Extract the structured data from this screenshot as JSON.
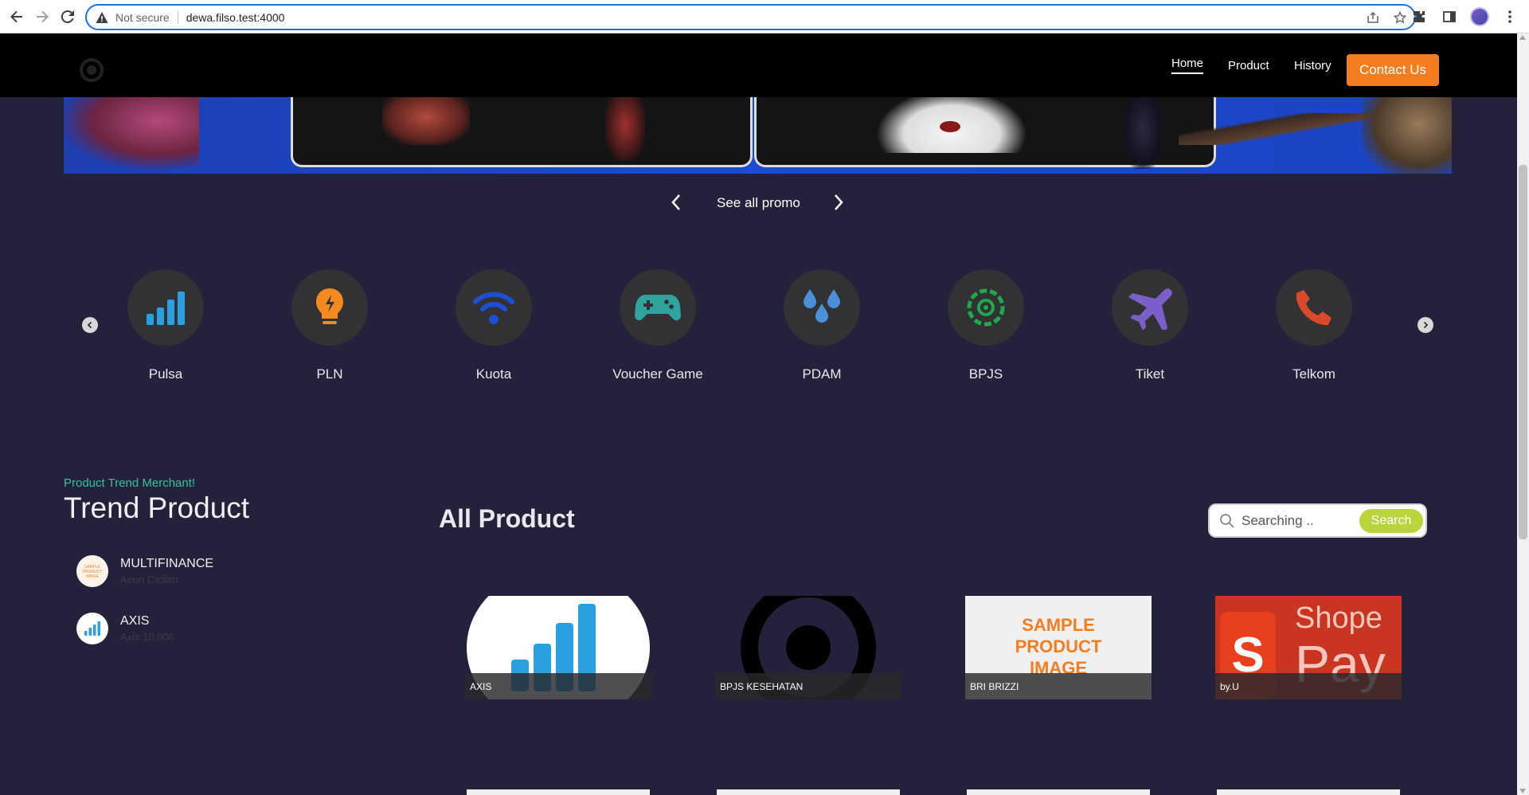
{
  "browser": {
    "security_label": "Not secure",
    "url": "dewa.filso.test:4000"
  },
  "site_nav": {
    "items": [
      {
        "label": "Home",
        "active": true
      },
      {
        "label": "Product",
        "active": false
      },
      {
        "label": "History",
        "active": false
      }
    ],
    "contact_label": "Contact Us",
    "accent": "#f47d1f"
  },
  "promo": {
    "label": "See all promo"
  },
  "categories": [
    {
      "label": "Pulsa",
      "icon": "signal-bars-icon",
      "color": "#2aa0e0"
    },
    {
      "label": "PLN",
      "icon": "lightbulb-icon",
      "color": "#f48a1d"
    },
    {
      "label": "Kuota",
      "icon": "wifi-icon",
      "color": "#1d4fd1"
    },
    {
      "label": "Voucher Game",
      "icon": "gamepad-icon",
      "color": "#2fa39d"
    },
    {
      "label": "PDAM",
      "icon": "water-drops-icon",
      "color": "#4a90d8"
    },
    {
      "label": "BPJS",
      "icon": "bpjs-logo-icon",
      "color": "#1fa94e"
    },
    {
      "label": "Tiket",
      "icon": "airplane-icon",
      "color": "#7b5fc9"
    },
    {
      "label": "Telkom",
      "icon": "phone-icon",
      "color": "#d84a2a"
    }
  ],
  "trend": {
    "subtitle": "Product Trend Merchant!",
    "title": "Trend Product",
    "items": [
      {
        "name": "MULTIFINANCE",
        "desc": "Aeon Cicilan",
        "thumb": "sample-product-image-icon"
      },
      {
        "name": "AXIS",
        "desc": "Axis 10.000",
        "thumb": "signal-bars-icon"
      }
    ]
  },
  "all_product": {
    "title": "All Product",
    "search_placeholder": "Searching ..",
    "search_label": "Search",
    "sample_image_text": "SAMPLE PRODUCT IMAGE",
    "products": [
      {
        "name": "AXIS",
        "image": "signal-bars-icon"
      },
      {
        "name": "BPJS KESEHATAN",
        "image": "ring-logo-icon"
      },
      {
        "name": "BRI BRIZZI",
        "image": "sample-product-image-icon"
      },
      {
        "name": "by.U",
        "image": "shopeepay-logo-icon"
      }
    ],
    "shopeepay_text": "ShopeePay"
  }
}
